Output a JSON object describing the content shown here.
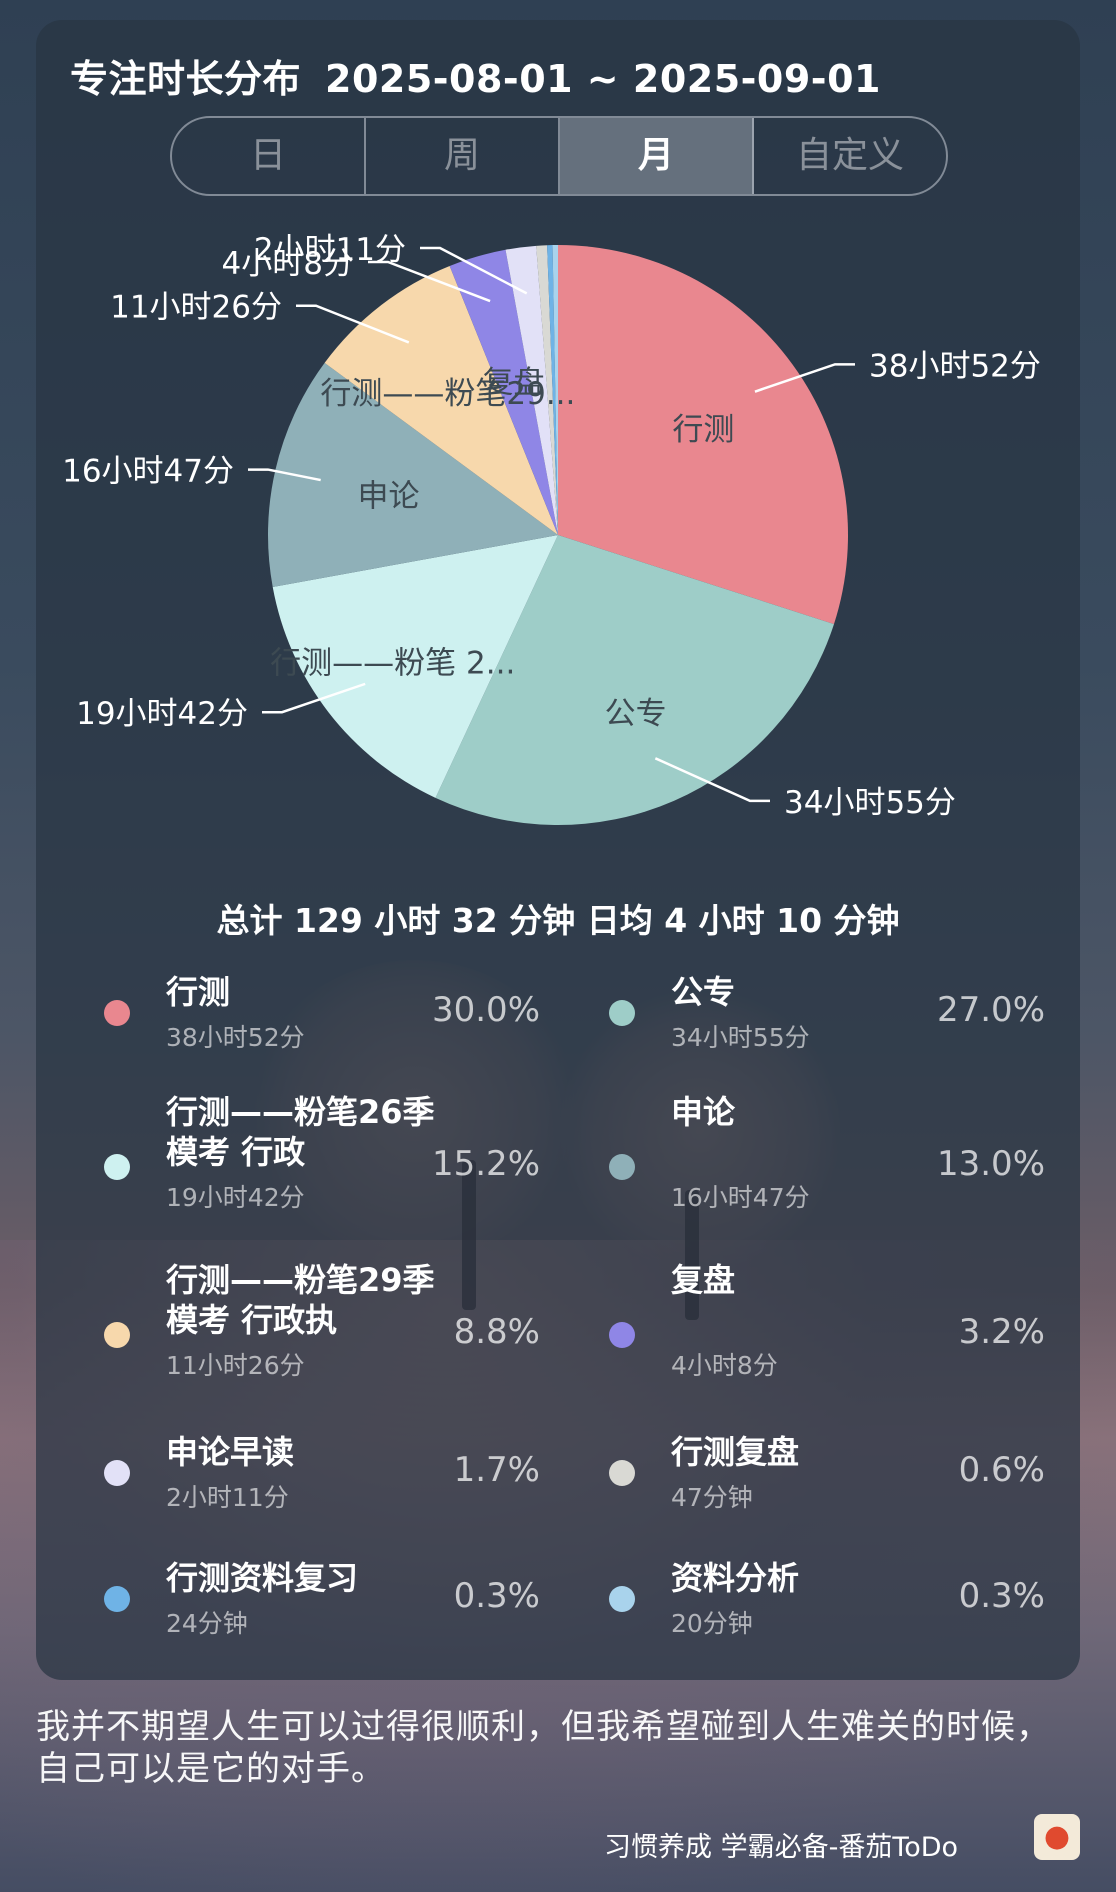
{
  "header": {
    "title": "专注时长分布",
    "date_range": "2025-08-01 ~ 2025-09-01"
  },
  "tabs": [
    {
      "label": "日",
      "active": false
    },
    {
      "label": "周",
      "active": false
    },
    {
      "label": "月",
      "active": true
    },
    {
      "label": "自定义",
      "active": false
    }
  ],
  "chart_data": {
    "type": "pie",
    "slices": [
      {
        "label": "行测",
        "pie_label": "行测",
        "value": 30.0,
        "duration": "38小时52分",
        "color": "#e9878f"
      },
      {
        "label": "公专",
        "pie_label": "公专",
        "value": 27.0,
        "duration": "34小时55分",
        "color": "#9ecdc8"
      },
      {
        "label": "行测——粉笔26季模考 行政",
        "pie_label": "行测——粉笔 2...",
        "value": 15.2,
        "duration": "19小时42分",
        "color": "#cef1f0"
      },
      {
        "label": "申论",
        "pie_label": "申论",
        "value": 13.0,
        "duration": "16小时47分",
        "color": "#8fb0b8"
      },
      {
        "label": "行测——粉笔29季模考 行政执",
        "pie_label": "行测——粉笔29...",
        "value": 8.8,
        "duration": "11小时26分",
        "color": "#f7d8ac"
      },
      {
        "label": "复盘",
        "pie_label": "复盘",
        "value": 3.2,
        "duration": "4小时8分",
        "color": "#8f86e6"
      },
      {
        "label": "申论早读",
        "pie_label": "",
        "value": 1.7,
        "duration": "2小时11分",
        "color": "#e2e1f7"
      },
      {
        "label": "行测复盘",
        "pie_label": "",
        "value": 0.6,
        "duration": "47分钟",
        "color": "#d9d9d4"
      },
      {
        "label": "行测资料复习",
        "pie_label": "",
        "value": 0.3,
        "duration": "24分钟",
        "color": "#6fb3e6"
      },
      {
        "label": "资料分析",
        "pie_label": "",
        "value": 0.3,
        "duration": "20分钟",
        "color": "#a9d3ec"
      }
    ],
    "callouts": [
      "38小时52分",
      "34小时55分",
      "19小时42分",
      "16小时47分",
      "11小时26分",
      "4小时8分",
      "2小时11分"
    ]
  },
  "summary": "总计 129 小时 32 分钟 日均 4 小时 10 分钟",
  "legend": [
    {
      "name": "行测",
      "duration": "38小时52分",
      "percent": "30.0%",
      "color": "#e9878f"
    },
    {
      "name": "公专",
      "duration": "34小时55分",
      "percent": "27.0%",
      "color": "#9ecdc8"
    },
    {
      "name": "行测——粉笔26季模考 行政",
      "duration": "19小时42分",
      "percent": "15.2%",
      "color": "#cef1f0"
    },
    {
      "name": "申论",
      "duration": "16小时47分",
      "percent": "13.0%",
      "color": "#8fb0b8"
    },
    {
      "name": "行测——粉笔29季模考 行政执",
      "duration": "11小时26分",
      "percent": "8.8%",
      "color": "#f7d8ac"
    },
    {
      "name": "复盘",
      "duration": "4小时8分",
      "percent": "3.2%",
      "color": "#8f86e6"
    },
    {
      "name": "申论早读",
      "duration": "2小时11分",
      "percent": "1.7%",
      "color": "#e2e1f7"
    },
    {
      "name": "行测复盘",
      "duration": "47分钟",
      "percent": "0.6%",
      "color": "#d9d9d4"
    },
    {
      "name": "行测资料复习",
      "duration": "24分钟",
      "percent": "0.3%",
      "color": "#6fb3e6"
    },
    {
      "name": "资料分析",
      "duration": "20分钟",
      "percent": "0.3%",
      "color": "#a9d3ec"
    }
  ],
  "quote": "我并不期望人生可以过得很顺利，但我希望碰到人生难关的时候，自己可以是它的对手。",
  "footer": {
    "text": "习惯养成 学霸必备-番茄ToDo",
    "icon": "tomato-icon"
  }
}
